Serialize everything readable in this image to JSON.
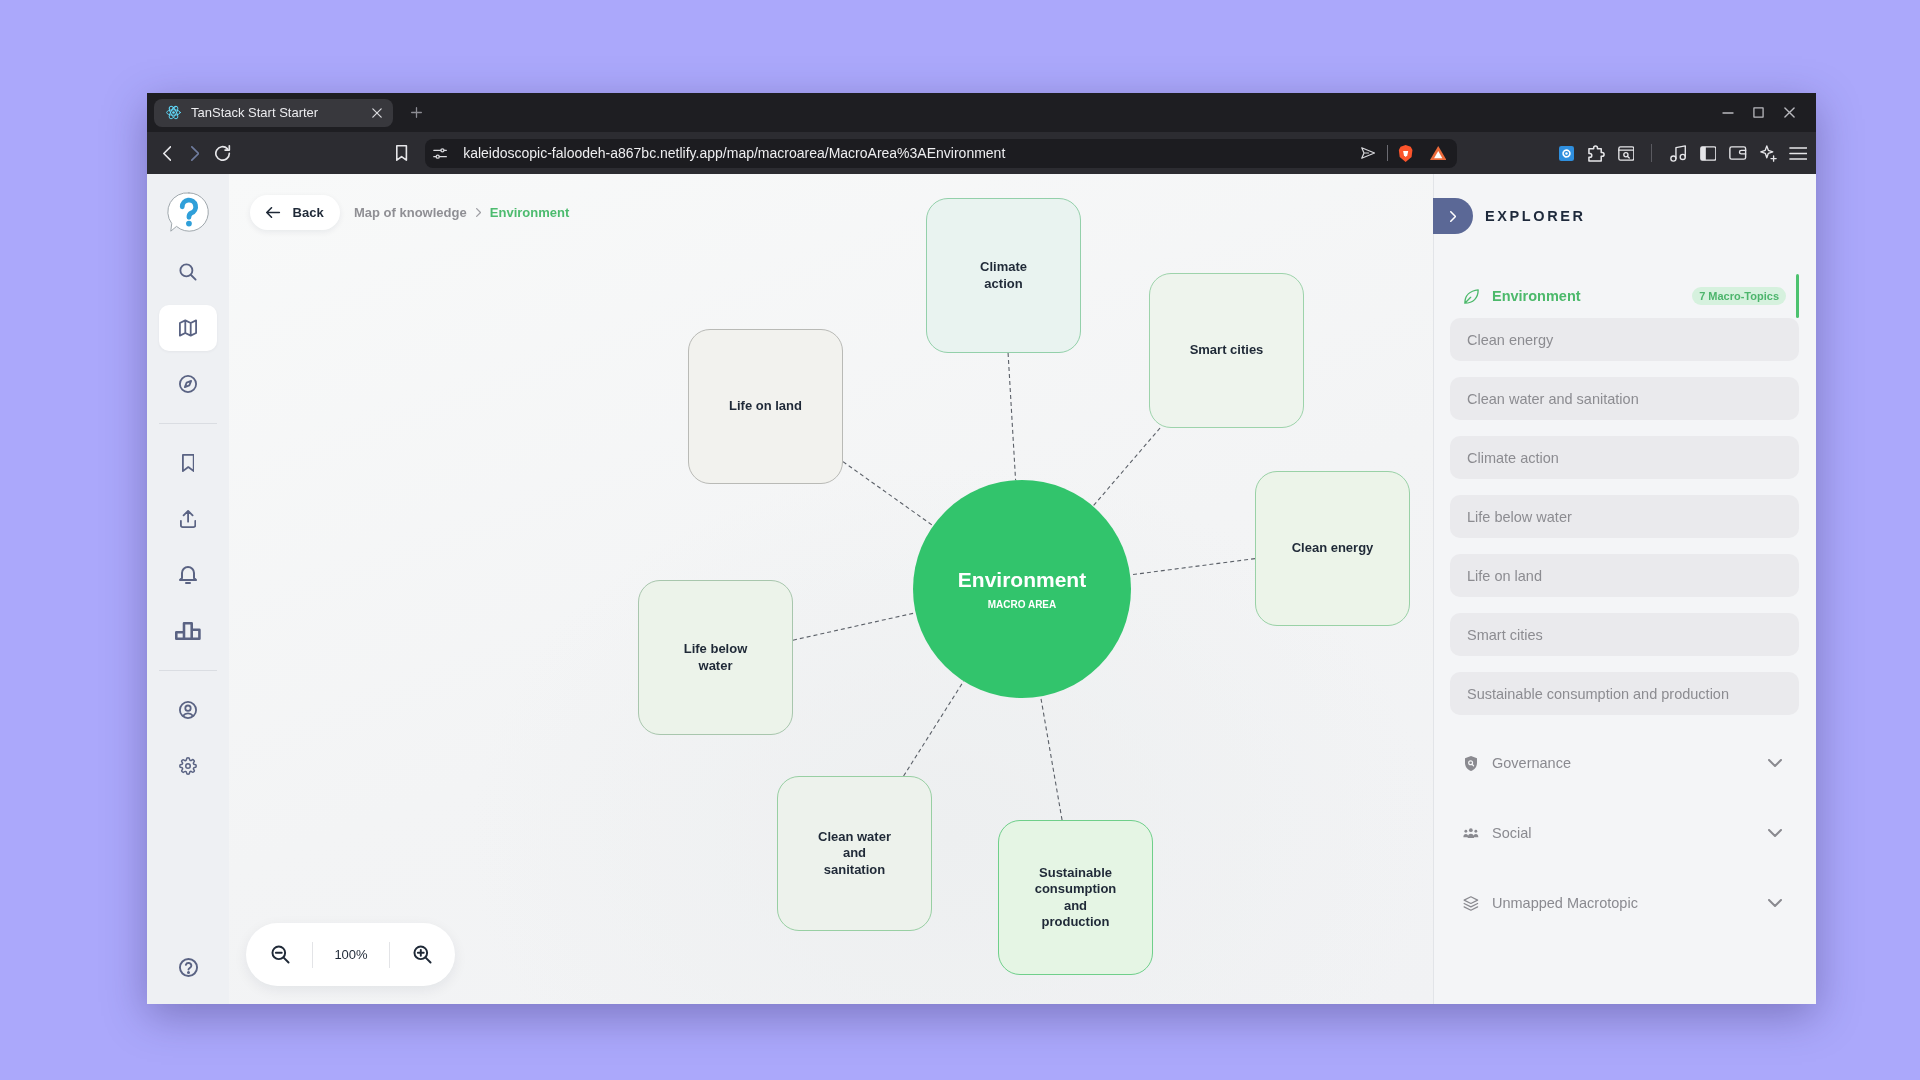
{
  "browser": {
    "tab": {
      "title": "TanStack Start Starter"
    },
    "nav_buttons": [
      {
        "disabled": false
      },
      {
        "disabled": true
      },
      {
        "disabled": false
      }
    ],
    "url": "kaleidoscopic-faloodeh-a867bc.netlify.app/map/macroarea/MacroArea%3AEnvironment"
  },
  "sidebar": {
    "groups": [
      {
        "items": [
          {
            "selected": false
          },
          {
            "selected": true
          },
          {
            "selected": false
          }
        ]
      },
      {
        "items": [
          {
            "selected": false
          },
          {
            "selected": false
          },
          {
            "selected": false
          },
          {
            "selected": false
          }
        ]
      },
      {
        "items": [
          {
            "selected": false
          },
          {
            "selected": false
          }
        ]
      }
    ]
  },
  "breadcrumb_bar": {
    "back": "Back",
    "crumbs": [
      {
        "label": "Map of knowledge",
        "current": false
      },
      {
        "label": "Environment",
        "current": true
      }
    ]
  },
  "map": {
    "center": {
      "title": "Environment",
      "subtitle": "MACRO AREA"
    },
    "nodes": [
      {
        "label": "Climate action"
      },
      {
        "label": "Smart cities"
      },
      {
        "label": "Life on land"
      },
      {
        "label": "Clean energy"
      },
      {
        "label": "Life below water"
      },
      {
        "label": "Clean water and sanitation"
      },
      {
        "label": "Sustainable consumption and production"
      }
    ]
  },
  "zoom": {
    "label": "100%"
  },
  "explorer": {
    "title": "EXPLORER",
    "sections": [
      {
        "label": "Environment",
        "selected": true,
        "expanded": true,
        "badge": "7 Macro-Topics",
        "items": [
          "Clean energy",
          "Clean water and sanitation",
          "Climate action",
          "Life below water",
          "Life on land",
          "Smart cities",
          "Sustainable consumption and production"
        ]
      },
      {
        "label": "Governance",
        "selected": false,
        "expanded": false
      },
      {
        "label": "Social",
        "selected": false,
        "expanded": false
      },
      {
        "label": "Unmapped Macrotopic",
        "selected": false,
        "expanded": false
      }
    ]
  }
}
